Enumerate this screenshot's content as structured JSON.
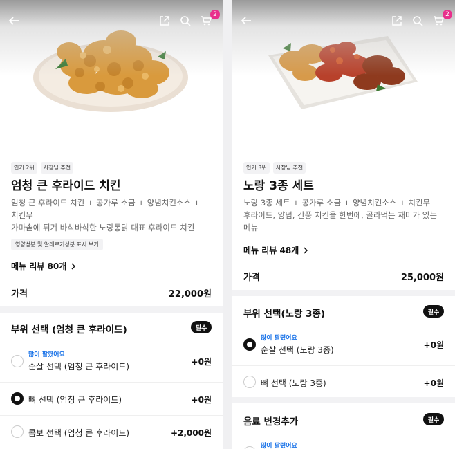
{
  "left": {
    "cart_count": "2",
    "tags": [
      "인기 2위",
      "사장님 추천"
    ],
    "title": "엄청 큰 후라이드 치킨",
    "desc1": "엄청 큰 후라이드 치킨 + 콩가루 소금 + 양념치킨소스 +",
    "desc2": "치킨무",
    "desc3": "가마솥에 튀겨 바삭바삭한 노랑통닭 대표 후라이드 치킨",
    "info_chip": "영양성분 및 알레르기성분 표시 보기",
    "reviews": "메뉴 리뷰 80개",
    "price_label": "가격",
    "price": "22,000원",
    "section_title": "부위 선택 (엄청 큰 후라이드)",
    "required": "필수",
    "options": [
      {
        "popular": "많이 팔렸어요",
        "label": "순살 선택 (엄청 큰 후라이드)",
        "price": "+0원",
        "selected": false
      },
      {
        "popular": "",
        "label": "뼈 선택 (엄청 큰 후라이드)",
        "price": "+0원",
        "selected": true
      },
      {
        "popular": "",
        "label": "콤보 선택 (엄청 큰 후라이드)",
        "price": "+2,000원",
        "selected": false
      }
    ]
  },
  "right": {
    "cart_count": "2",
    "tags": [
      "인기 3위",
      "사장님 추천"
    ],
    "title": "노랑 3종 세트",
    "desc1": "노랑 3종 세트 + 콩가루 소금 + 양념치킨소스 + 치킨무",
    "desc2": "후라이드, 양념, 간풍 치킨을 한번에, 골라먹는 재미가 있는",
    "desc3": "메뉴",
    "reviews": "메뉴 리뷰 48개",
    "price_label": "가격",
    "price": "25,000원",
    "section_title": "부위 선택(노랑 3종)",
    "required": "필수",
    "options": [
      {
        "popular": "많이 팔렸어요",
        "label": "순살 선택 (노랑 3종)",
        "price": "+0원",
        "selected": true
      },
      {
        "popular": "",
        "label": "뼈 선택 (노랑 3종)",
        "price": "+0원",
        "selected": false
      }
    ],
    "section2_title": "음료 변경추가",
    "required2": "필수",
    "option3_popular": "많이 팔렸어요"
  },
  "colors": {
    "accent": "#e8308c",
    "popular": "#1a73e8"
  }
}
